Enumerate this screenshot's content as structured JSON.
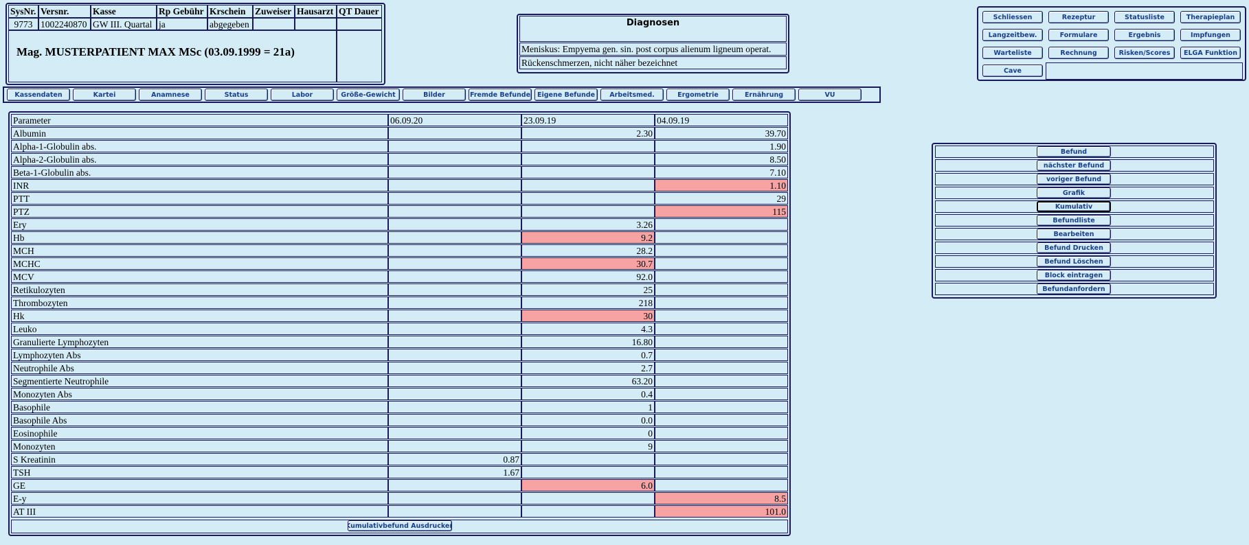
{
  "patient_header": {
    "columns": [
      "SysNr.",
      "Versnr.",
      "Kasse",
      "Rp Gebühr",
      "Krschein",
      "Zuweiser",
      "Hausarzt",
      "QT Dauer"
    ],
    "values": [
      "9773",
      "1002240870",
      "GW III. Quartal",
      "ja",
      "abgegeben",
      "",
      "",
      ""
    ],
    "patient_name": "Mag. MUSTERPATIENT MAX MSc (03.09.1999 = 21a)"
  },
  "diagnosen": {
    "title": "Diagnosen",
    "items": [
      "Meniskus: Empyema gen. sin. post corpus alienum ligneum operat.",
      "Rückenschmerzen, nicht näher bezeichnet"
    ]
  },
  "top_buttons": [
    [
      "Schliessen",
      "Rezeptur",
      "Statusliste",
      "Therapieplan"
    ],
    [
      "Langzeitbew.",
      "Formulare",
      "Ergebnis",
      "Impfungen"
    ],
    [
      "Warteliste",
      "Rechnung",
      "Risken/Scores",
      "ELGA Funktion"
    ],
    [
      "Cave"
    ]
  ],
  "tabs": [
    "Kassendaten",
    "Kartei",
    "Anamnese",
    "Status",
    "Labor",
    "Größe-Gewicht",
    "Bilder",
    "Fremde Befunde",
    "Eigene Befunde",
    "Arbeitsmed.",
    "Ergometrie",
    "Ernährung",
    "VU"
  ],
  "lab": {
    "header": [
      "Parameter",
      "06.09.20",
      "23.09.19",
      "04.09.19"
    ],
    "rows": [
      {
        "name": "Albumin",
        "v": [
          "",
          "2.30",
          "39.70"
        ],
        "hi": [
          false,
          false,
          false
        ]
      },
      {
        "name": "Alpha-1-Globulin abs.",
        "v": [
          "",
          "",
          "1.90"
        ],
        "hi": [
          false,
          false,
          false
        ]
      },
      {
        "name": "Alpha-2-Globulin abs.",
        "v": [
          "",
          "",
          "8.50"
        ],
        "hi": [
          false,
          false,
          false
        ]
      },
      {
        "name": "Beta-1-Globulin abs.",
        "v": [
          "",
          "",
          "7.10"
        ],
        "hi": [
          false,
          false,
          false
        ]
      },
      {
        "name": "INR",
        "v": [
          "",
          "",
          "1.10"
        ],
        "hi": [
          false,
          false,
          true
        ]
      },
      {
        "name": "PTT",
        "v": [
          "",
          "",
          "29"
        ],
        "hi": [
          false,
          false,
          false
        ]
      },
      {
        "name": "PTZ",
        "v": [
          "",
          "",
          "115"
        ],
        "hi": [
          false,
          false,
          true
        ]
      },
      {
        "name": "Ery",
        "v": [
          "",
          "3.26",
          ""
        ],
        "hi": [
          false,
          false,
          false
        ]
      },
      {
        "name": "Hb",
        "v": [
          "",
          "9.2",
          ""
        ],
        "hi": [
          false,
          true,
          false
        ]
      },
      {
        "name": "MCH",
        "v": [
          "",
          "28.2",
          ""
        ],
        "hi": [
          false,
          false,
          false
        ]
      },
      {
        "name": "MCHC",
        "v": [
          "",
          "30.7",
          ""
        ],
        "hi": [
          false,
          true,
          false
        ]
      },
      {
        "name": "MCV",
        "v": [
          "",
          "92.0",
          ""
        ],
        "hi": [
          false,
          false,
          false
        ]
      },
      {
        "name": "Retikulozyten",
        "v": [
          "",
          "25",
          ""
        ],
        "hi": [
          false,
          false,
          false
        ]
      },
      {
        "name": "Thrombozyten",
        "v": [
          "",
          "218",
          ""
        ],
        "hi": [
          false,
          false,
          false
        ]
      },
      {
        "name": "Hk",
        "v": [
          "",
          "30",
          ""
        ],
        "hi": [
          false,
          true,
          false
        ]
      },
      {
        "name": "Leuko",
        "v": [
          "",
          "4.3",
          ""
        ],
        "hi": [
          false,
          false,
          false
        ]
      },
      {
        "name": "Granulierte Lymphozyten",
        "v": [
          "",
          "16.80",
          ""
        ],
        "hi": [
          false,
          false,
          false
        ]
      },
      {
        "name": "Lymphozyten Abs",
        "v": [
          "",
          "0.7",
          ""
        ],
        "hi": [
          false,
          false,
          false
        ]
      },
      {
        "name": "Neutrophile Abs",
        "v": [
          "",
          "2.7",
          ""
        ],
        "hi": [
          false,
          false,
          false
        ]
      },
      {
        "name": "Segmentierte Neutrophile",
        "v": [
          "",
          "63.20",
          ""
        ],
        "hi": [
          false,
          false,
          false
        ]
      },
      {
        "name": "Monozyten Abs",
        "v": [
          "",
          "0.4",
          ""
        ],
        "hi": [
          false,
          false,
          false
        ]
      },
      {
        "name": "Basophile",
        "v": [
          "",
          "1",
          ""
        ],
        "hi": [
          false,
          false,
          false
        ]
      },
      {
        "name": "Basophile Abs",
        "v": [
          "",
          "0.0",
          ""
        ],
        "hi": [
          false,
          false,
          false
        ]
      },
      {
        "name": "Eosinophile",
        "v": [
          "",
          "0",
          ""
        ],
        "hi": [
          false,
          false,
          false
        ]
      },
      {
        "name": "Monozyten",
        "v": [
          "",
          "9",
          ""
        ],
        "hi": [
          false,
          false,
          false
        ]
      },
      {
        "name": "S Kreatinin",
        "v": [
          "0.87",
          "",
          ""
        ],
        "hi": [
          false,
          false,
          false
        ]
      },
      {
        "name": "TSH",
        "v": [
          "1.67",
          "",
          ""
        ],
        "hi": [
          false,
          false,
          false
        ]
      },
      {
        "name": "GE",
        "v": [
          "",
          "6.0",
          ""
        ],
        "hi": [
          false,
          true,
          false
        ]
      },
      {
        "name": "E-y",
        "v": [
          "",
          "",
          "8.5"
        ],
        "hi": [
          false,
          false,
          true
        ]
      },
      {
        "name": "AT III",
        "v": [
          "",
          "",
          "101.0"
        ],
        "hi": [
          false,
          false,
          true
        ]
      }
    ],
    "print_button": "Kumulativbefund Ausdrucken"
  },
  "side_buttons": [
    "Befund",
    "nächster Befund",
    "voriger Befund",
    "Grafik",
    "Kumulativ",
    "Befundliste",
    "Bearbeiten",
    "Befund Drucken",
    "Befund Löschen",
    "Block eintragen",
    "Befundanfordern"
  ],
  "side_active": "Kumulativ",
  "colors": {
    "background": "#d4ecf6",
    "highlight": "#f7a3a3",
    "border": "#1a1a5a",
    "button_text": "#1b3f8a"
  }
}
